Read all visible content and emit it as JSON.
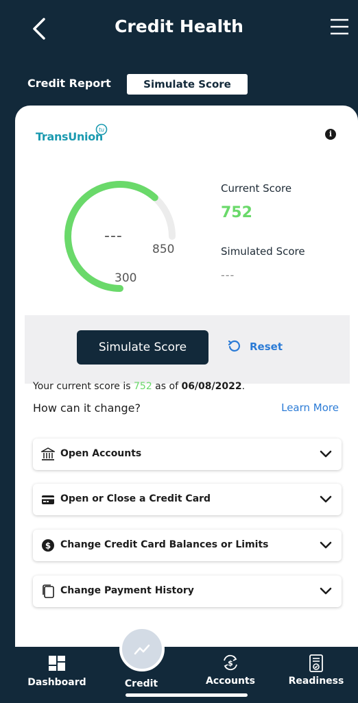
{
  "header": {
    "title": "Credit Health",
    "back_icon": "chevron-left-icon",
    "menu_icon": "hamburger-icon"
  },
  "tabs": [
    {
      "label": "Credit Report",
      "active": false
    },
    {
      "label": "Simulate Score",
      "active": true
    }
  ],
  "provider": {
    "name": "TransUnion",
    "badge": "tu"
  },
  "gauge": {
    "current_value": 752,
    "min": 300,
    "max": 850,
    "simulated_display": "---",
    "min_label": "300",
    "max_label": "850"
  },
  "scores": {
    "current_label": "Current Score",
    "current_value": "752",
    "simulated_label": "Simulated Score",
    "simulated_value": "---"
  },
  "actions": {
    "simulate_label": "Simulate Score",
    "reset_label": "Reset"
  },
  "note": {
    "prefix": "Your current score is ",
    "score": "752",
    "middle": " as of ",
    "date": "06/08/2022",
    "suffix": "."
  },
  "how": {
    "question": "How can it change?",
    "learn_more": "Learn More"
  },
  "accordions": [
    {
      "label": "Open Accounts",
      "icon": "bank-icon"
    },
    {
      "label": "Open or Close a Credit Card",
      "icon": "credit-card-icon"
    },
    {
      "label": "Change Credit Card Balances or Limits",
      "icon": "dollar-icon"
    },
    {
      "label": "Change Payment History",
      "icon": "documents-icon"
    }
  ],
  "bottom_nav": [
    {
      "label": "Dashboard",
      "icon": "dashboard-icon"
    },
    {
      "label": "Credit",
      "icon": "trend-icon",
      "active": true
    },
    {
      "label": "Accounts",
      "icon": "refresh-dollar-icon"
    },
    {
      "label": "Readiness",
      "icon": "checklist-icon"
    }
  ],
  "colors": {
    "navy": "#12293a",
    "green": "#6ad96a",
    "blue_link": "#2b7bd6",
    "teal": "#1b9ab0"
  }
}
